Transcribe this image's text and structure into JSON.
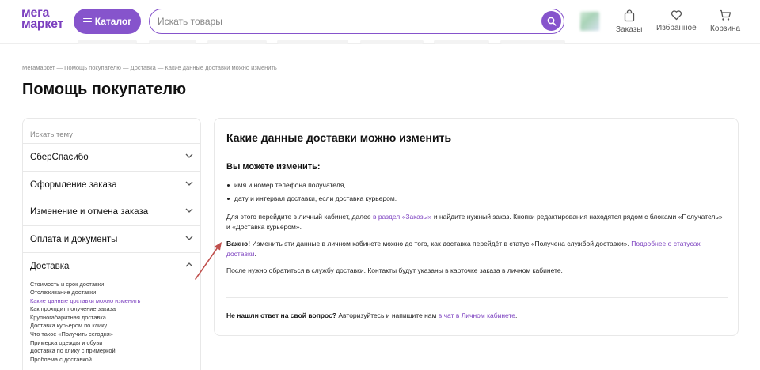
{
  "header": {
    "logo_line1": "мега",
    "logo_line2": "маркет",
    "catalog_label": "Каталог",
    "search_placeholder": "Искать товары",
    "orders_label": "Заказы",
    "favorites_label": "Избранное",
    "cart_label": "Корзина"
  },
  "breadcrumb": "Мегамаркет — Помощь покупателю — Доставка — Какие данные доставки можно изменить",
  "page_title": "Помощь покупателю",
  "sidebar": {
    "search_placeholder": "Искать тему",
    "categories": [
      {
        "label": "СберСпасибо",
        "expanded": false
      },
      {
        "label": "Оформление заказа",
        "expanded": false
      },
      {
        "label": "Изменение и отмена заказа",
        "expanded": false
      },
      {
        "label": "Оплата и документы",
        "expanded": false
      },
      {
        "label": "Доставка",
        "expanded": true
      }
    ],
    "delivery_items": [
      "Стоимость и срок доставки",
      "Отслеживание доставки",
      "Какие данные доставки можно изменить",
      "Как проходит получение заказа",
      "Крупногабаритная доставка",
      "Доставка курьером по клику",
      "Что такое «Получить сегодня»",
      "Примерка одежды и обуви",
      "Доставка по клику с примеркой",
      "Проблема с доставкой"
    ],
    "active_item_index": 2
  },
  "article": {
    "title": "Какие данные доставки можно изменить",
    "subtitle": "Вы можете изменить:",
    "bullets": [
      "имя и номер телефона получателя,",
      "дату и интервал доставки, если доставка курьером."
    ],
    "p1_before": "Для этого перейдите в личный кабинет, далее ",
    "p1_link": "в раздел «Заказы»",
    "p1_after": " и найдите нужный заказ. Кнопки редактирования находятся рядом с блоками «Получатель» и «Доставка курьером».",
    "p2_bold": "Важно!",
    "p2_text": " Изменить эти данные в личном кабинете можно до того, как доставка перейдёт в статус «Получена службой доставки». ",
    "p2_link": "Подробнее о статусах доставки",
    "p2_end": ".",
    "p3": "После нужно обратиться в службу доставки. Контакты будут указаны в карточке заказа в личном кабинете.",
    "footer_bold": "Не нашли ответ на свой вопрос?",
    "footer_text": " Авторизуйтесь и напишите нам ",
    "footer_link": "в чат в Личном кабинете",
    "footer_end": "."
  },
  "colors": {
    "brand": "#8654cc",
    "link": "#7b3fbf",
    "annotation_arrow": "#c0504d"
  }
}
